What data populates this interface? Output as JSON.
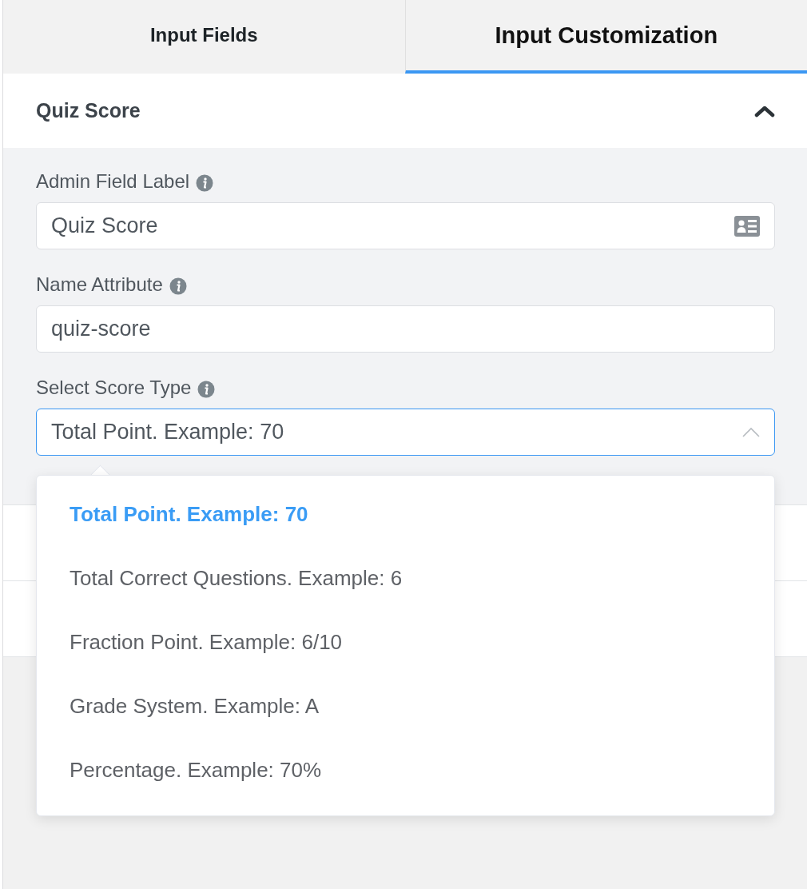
{
  "tabs": [
    {
      "label": "Input Fields",
      "selected": false
    },
    {
      "label": "Input Customization",
      "selected": true
    }
  ],
  "panel": {
    "title": "Quiz Score",
    "expanded": true,
    "fields": [
      {
        "kind": "text",
        "label": "Admin Field Label",
        "value": "Quiz Score",
        "has_icon": true
      },
      {
        "kind": "text",
        "label": "Name Attribute",
        "value": "quiz-score",
        "has_icon": false
      },
      {
        "kind": "select",
        "label": "Select Score Type",
        "value": "Total Point. Example: 70",
        "open": true,
        "options": [
          {
            "label": "Total Point. Example: 70",
            "selected": true
          },
          {
            "label": "Total Correct Questions. Example: 6",
            "selected": false
          },
          {
            "label": "Fraction Point. Example: 6/10",
            "selected": false
          },
          {
            "label": "Grade System. Example: A",
            "selected": false
          },
          {
            "label": "Percentage. Example: 70%",
            "selected": false
          }
        ]
      }
    ]
  }
}
